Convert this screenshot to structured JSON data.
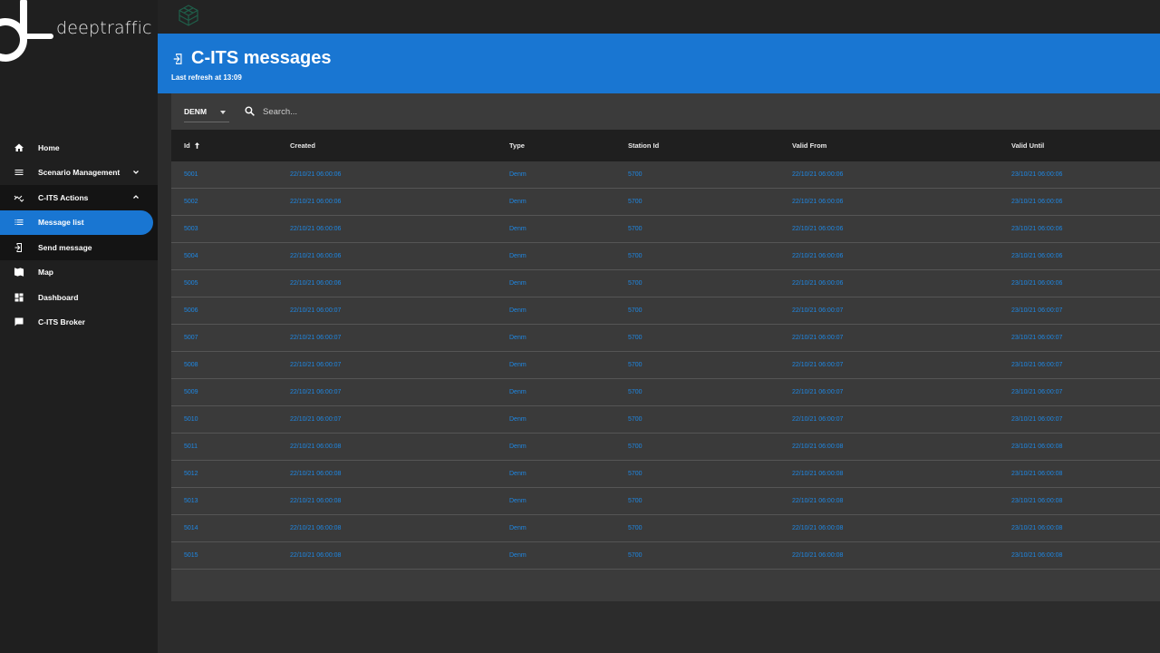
{
  "app": {
    "logo_text": "deeptraffic"
  },
  "sidebar": {
    "items": [
      {
        "label": "Home",
        "icon": "home-icon"
      },
      {
        "label": "Scenario Management",
        "icon": "menu-icon",
        "chevron": "down"
      },
      {
        "label": "C-ITS Actions",
        "icon": "c-its-actions-icon",
        "chevron": "up"
      },
      {
        "label": "Message list",
        "icon": "list-icon",
        "active": true
      },
      {
        "label": "Send message",
        "icon": "send-message-icon"
      },
      {
        "label": "Map",
        "icon": "map-icon"
      },
      {
        "label": "Dashboard",
        "icon": "dashboard-icon"
      },
      {
        "label": "C-ITS Broker",
        "icon": "chat-icon"
      }
    ]
  },
  "header": {
    "title": "C-ITS messages",
    "subtitle": "Last refresh at 13:09"
  },
  "toolbar": {
    "filter_value": "DENM",
    "search_placeholder": "Search..."
  },
  "table": {
    "columns": [
      "Id",
      "Created",
      "Type",
      "Station Id",
      "Valid From",
      "Valid Until"
    ],
    "sort": {
      "column": "Id",
      "direction": "asc"
    },
    "rows": [
      [
        "5001",
        "22/10/21 06:00:06",
        "Denm",
        "5700",
        "22/10/21 06:00:06",
        "23/10/21 06:00:06"
      ],
      [
        "5002",
        "22/10/21 06:00:06",
        "Denm",
        "5700",
        "22/10/21 06:00:06",
        "23/10/21 06:00:06"
      ],
      [
        "5003",
        "22/10/21 06:00:06",
        "Denm",
        "5700",
        "22/10/21 06:00:06",
        "23/10/21 06:00:06"
      ],
      [
        "5004",
        "22/10/21 06:00:06",
        "Denm",
        "5700",
        "22/10/21 06:00:06",
        "23/10/21 06:00:06"
      ],
      [
        "5005",
        "22/10/21 06:00:06",
        "Denm",
        "5700",
        "22/10/21 06:00:06",
        "23/10/21 06:00:06"
      ],
      [
        "5006",
        "22/10/21 06:00:07",
        "Denm",
        "5700",
        "22/10/21 06:00:07",
        "23/10/21 06:00:07"
      ],
      [
        "5007",
        "22/10/21 06:00:07",
        "Denm",
        "5700",
        "22/10/21 06:00:07",
        "23/10/21 06:00:07"
      ],
      [
        "5008",
        "22/10/21 06:00:07",
        "Denm",
        "5700",
        "22/10/21 06:00:07",
        "23/10/21 06:00:07"
      ],
      [
        "5009",
        "22/10/21 06:00:07",
        "Denm",
        "5700",
        "22/10/21 06:00:07",
        "23/10/21 06:00:07"
      ],
      [
        "5010",
        "22/10/21 06:00:07",
        "Denm",
        "5700",
        "22/10/21 06:00:07",
        "23/10/21 06:00:07"
      ],
      [
        "5011",
        "22/10/21 06:00:08",
        "Denm",
        "5700",
        "22/10/21 06:00:08",
        "23/10/21 06:00:08"
      ],
      [
        "5012",
        "22/10/21 06:00:08",
        "Denm",
        "5700",
        "22/10/21 06:00:08",
        "23/10/21 06:00:08"
      ],
      [
        "5013",
        "22/10/21 06:00:08",
        "Denm",
        "5700",
        "22/10/21 06:00:08",
        "23/10/21 06:00:08"
      ],
      [
        "5014",
        "22/10/21 06:00:08",
        "Denm",
        "5700",
        "22/10/21 06:00:08",
        "23/10/21 06:00:08"
      ],
      [
        "5015",
        "22/10/21 06:00:08",
        "Denm",
        "5700",
        "22/10/21 06:00:08",
        "23/10/21 06:00:08"
      ]
    ]
  },
  "colors": {
    "accent": "#1976d2",
    "link": "#1e88e5",
    "sidebar_bg": "#1f1f1f",
    "row_bg": "#3a3a3a"
  }
}
